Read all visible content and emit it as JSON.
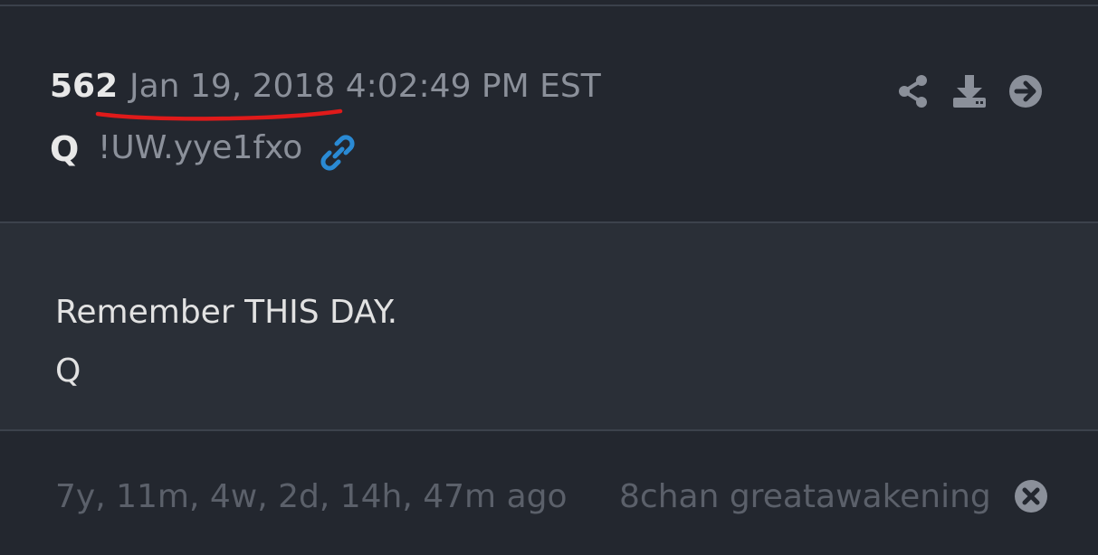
{
  "post": {
    "number": "562",
    "date": "Jan 19, 2018 4:02:49 PM EST",
    "author": "Q",
    "tripcode": "!UW.yye1fxo"
  },
  "actions": [
    {
      "icon": "share-icon"
    },
    {
      "icon": "download-icon"
    },
    {
      "icon": "arrow-right-circle-icon"
    }
  ],
  "message": {
    "line1": "Remember THIS DAY.",
    "line2": "Q"
  },
  "footer": {
    "elapsed": "7y, 11m, 4w, 2d, 14h, 47m ago",
    "source": "8chan greatawakening"
  },
  "colors": {
    "background": "#23272f",
    "body_background": "#2a2f37",
    "link_accent": "#2a8ad4",
    "underline_mark": "#e01a1a"
  }
}
